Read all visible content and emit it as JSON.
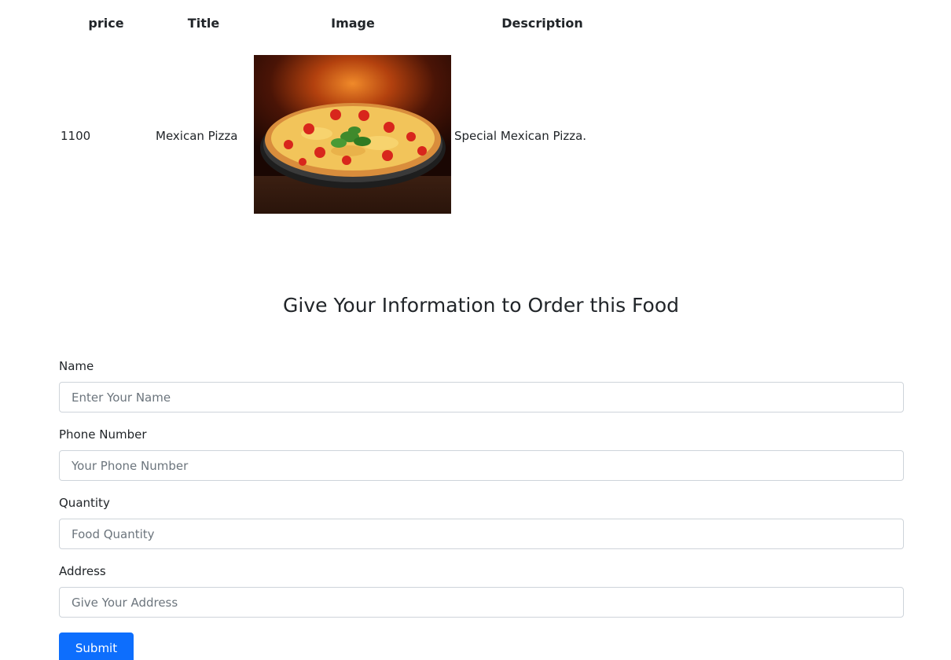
{
  "table": {
    "headers": {
      "price": "price",
      "title": "Title",
      "image": "Image",
      "description": "Description"
    },
    "rows": [
      {
        "price": "1100",
        "title": "Mexican Pizza",
        "image": "pizza-photo",
        "description": "Special Mexican Pizza."
      }
    ]
  },
  "order": {
    "heading": "Give Your Information to Order this Food",
    "fields": [
      {
        "label": "Name",
        "placeholder": "Enter Your Name"
      },
      {
        "label": "Phone Number",
        "placeholder": "Your Phone Number"
      },
      {
        "label": "Quantity",
        "placeholder": "Food Quantity"
      },
      {
        "label": "Address",
        "placeholder": "Give Your Address"
      }
    ],
    "submit_label": "Submit"
  },
  "colors": {
    "primary_button": "#0d6efd",
    "input_border": "#ced4da",
    "text": "#212529"
  }
}
